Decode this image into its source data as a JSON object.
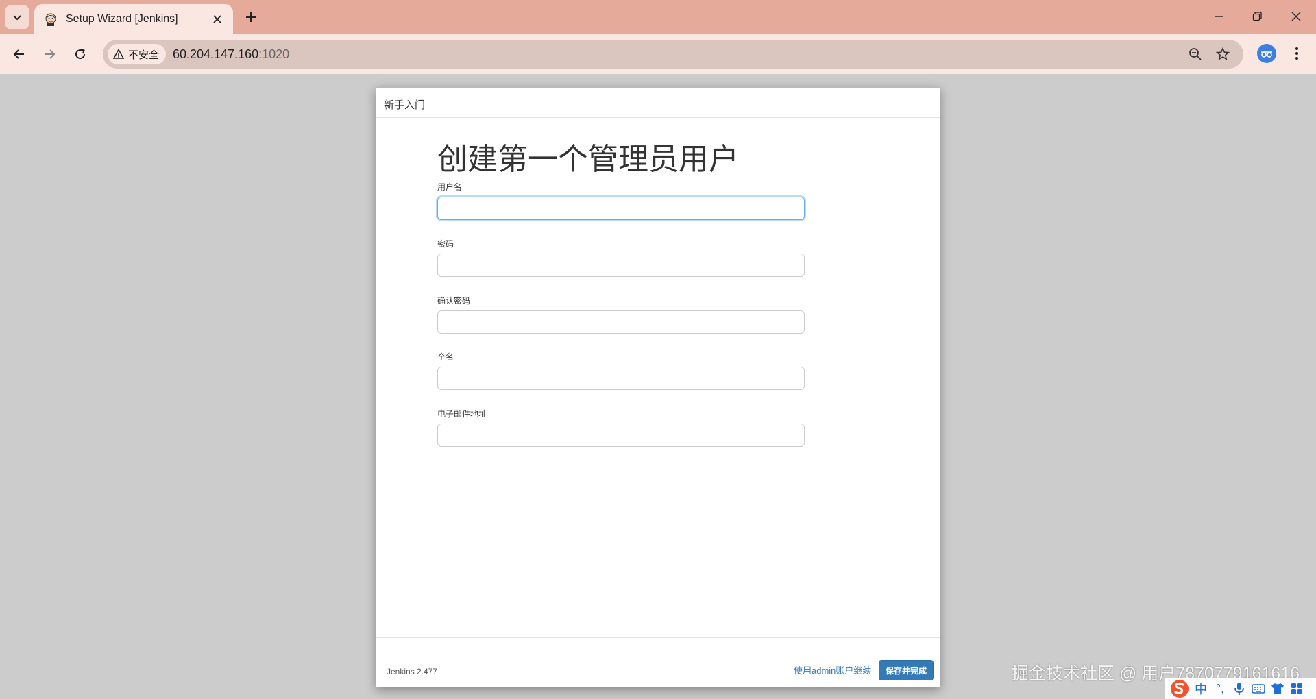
{
  "browser": {
    "tab_title": "Setup Wizard [Jenkins]",
    "security_chip": "不安全",
    "url_host": "60.204.147.160",
    "url_port": ":1020"
  },
  "dialog": {
    "header_title": "新手入门",
    "heading": "创建第一个管理员用户",
    "fields": [
      {
        "label": "用户名"
      },
      {
        "label": "密码"
      },
      {
        "label": "确认密码"
      },
      {
        "label": "全名"
      },
      {
        "label": "电子邮件地址"
      }
    ],
    "version": "Jenkins 2.477",
    "skip_link": "使用admin账户继续",
    "save_button": "保存并完成"
  },
  "watermark": "掘金技术社区 @ 用户7870779161616",
  "ime": {
    "lang": "中",
    "punct": "°,"
  },
  "colors": {
    "tabbar": "#e5aa99",
    "toolbar": "#fbe7e1",
    "page_bg": "#cccccc",
    "primary": "#337ab7",
    "focus": "#66afe9"
  }
}
